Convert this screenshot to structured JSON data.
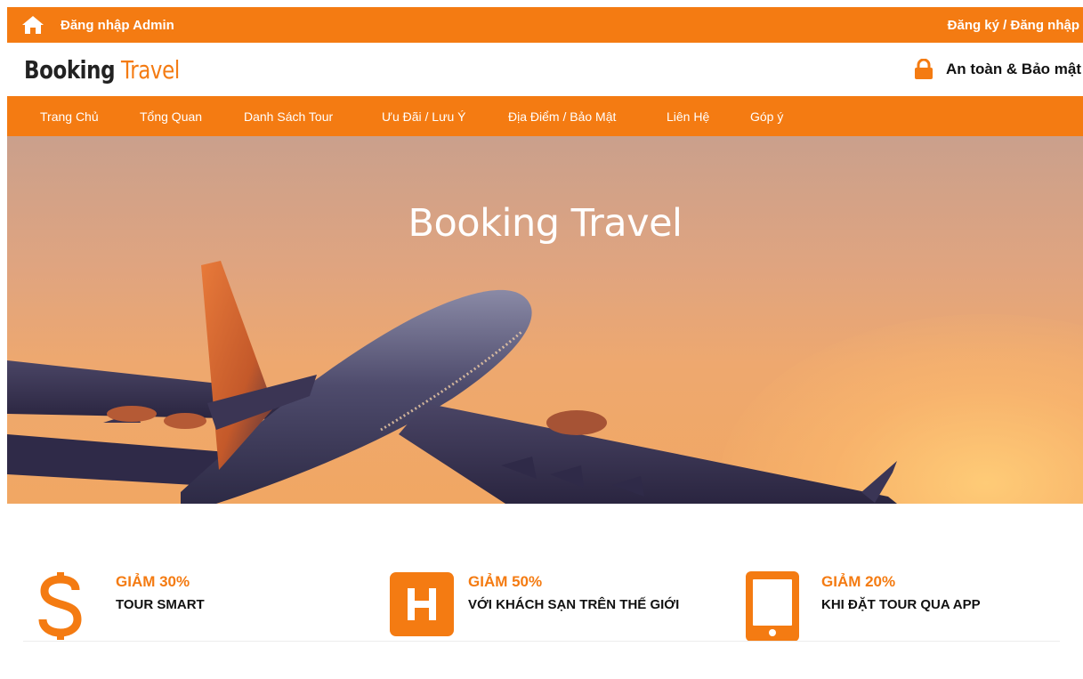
{
  "topbar": {
    "admin_login": "Đăng nhập Admin",
    "register_login": "Đăng ký / Đăng nhập"
  },
  "brand": {
    "logo_part1": "Booking",
    "logo_part2": "Travel",
    "secure_text": "An toàn & Bảo mật"
  },
  "nav": {
    "items": [
      {
        "label": "Trang Chủ"
      },
      {
        "label": "Tổng Quan"
      },
      {
        "label": "Danh Sách Tour"
      },
      {
        "label": "Ưu Đãi / Lưu Ý"
      },
      {
        "label": "Địa Điểm / Bảo Mật"
      },
      {
        "label": "Liên Hệ"
      },
      {
        "label": "Góp ý"
      }
    ]
  },
  "hero": {
    "title": "Booking Travel"
  },
  "features": [
    {
      "icon": "dollar-icon",
      "title": "GIẢM 30%",
      "subtitle": "TOUR SMART"
    },
    {
      "icon": "hotel-icon",
      "title": "GIẢM 50%",
      "subtitle": "VỚI KHÁCH SẠN TRÊN THẾ GIỚI"
    },
    {
      "icon": "mobile-icon",
      "title": "GIẢM 20%",
      "subtitle": "KHI ĐẶT TOUR QUA APP"
    }
  ],
  "colors": {
    "accent": "#f47b12",
    "text_dark": "#111111",
    "white": "#ffffff"
  }
}
